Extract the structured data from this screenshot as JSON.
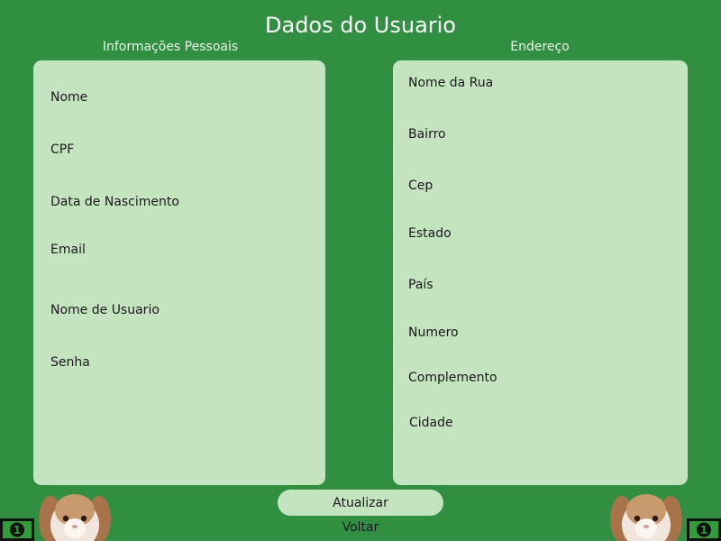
{
  "page": {
    "title": "Dados do Usuario"
  },
  "personal": {
    "heading": "Informações Pessoais",
    "fields": [
      "Nome",
      "CPF",
      "Data de Nascimento",
      "Email",
      "Nome de Usuario",
      "Senha"
    ]
  },
  "address": {
    "heading": "Endereço",
    "fields": [
      "Nome da Rua",
      "Bairro",
      "Cep",
      "Estado",
      "País",
      "Numero",
      "Complemento",
      "Cidade"
    ]
  },
  "actions": {
    "update_label": "Atualizar",
    "back_label": "Voltar"
  },
  "decor": {
    "money_badge_text": "1"
  },
  "colors": {
    "background": "#318f42",
    "panel": "#c4e4c0",
    "title_text": "#ffffff",
    "body_text": "#1a1a1a"
  }
}
